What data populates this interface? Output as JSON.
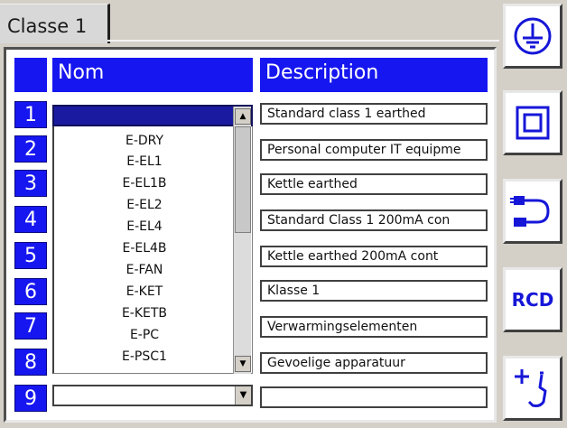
{
  "tab": {
    "label": "Classe 1"
  },
  "table": {
    "header_name": "Nom",
    "header_description": "Description",
    "row_numbers": [
      "1",
      "2",
      "3",
      "4",
      "5",
      "6",
      "7",
      "8",
      "9"
    ],
    "name_row1_value": "",
    "name_row9_value": "",
    "dropdown_items": [
      "E-DRY",
      "E-EL1",
      "E-EL1B",
      "E-EL2",
      "E-EL4",
      "E-EL4B",
      "E-FAN",
      "E-KET",
      "E-KETB",
      "E-PC",
      "E-PSC1"
    ],
    "descriptions": [
      "Standard class 1 earthed",
      "Personal computer IT equipme",
      "Kettle earthed",
      "Standard Class 1 200mA con",
      "Kettle earthed 200mA cont",
      "Klasse 1",
      "Verwarmingselementen",
      "Gevoelige apparatuur",
      ""
    ]
  },
  "side_buttons": {
    "earth_icon": "earth-ground-icon",
    "class2_icon": "double-square-icon",
    "lead_icon": "iec-lead-icon",
    "rcd_label": "RCD",
    "plus_icon": "plus-probe-icon"
  },
  "colors": {
    "header_blue": "#1616f0",
    "selected_row": "#1a1aa0",
    "icon_blue": "#1616d8"
  }
}
